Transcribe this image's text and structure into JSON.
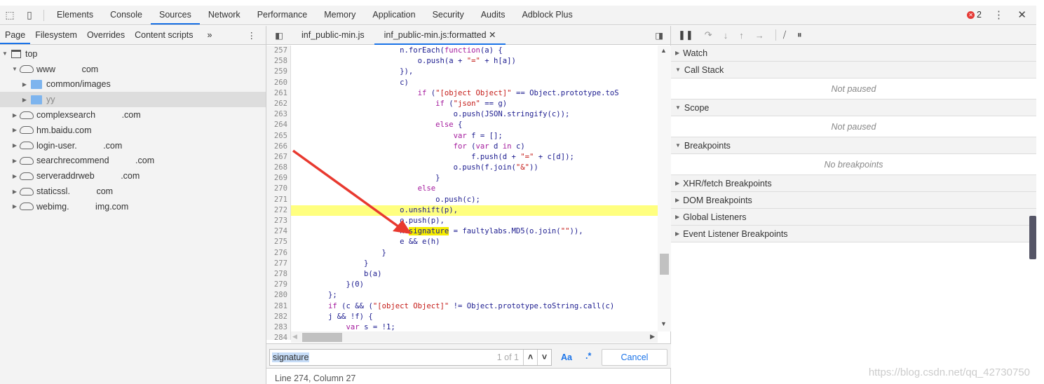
{
  "toolbar": {
    "tabs": [
      "Elements",
      "Console",
      "Sources",
      "Network",
      "Performance",
      "Memory",
      "Application",
      "Security",
      "Audits",
      "Adblock Plus"
    ],
    "active": "Sources",
    "error_count": "2"
  },
  "navigator": {
    "tabs": [
      "Page",
      "Filesystem",
      "Overrides",
      "Content scripts"
    ],
    "more": "»",
    "tree": [
      {
        "label": "top",
        "type": "frame",
        "expanded": true,
        "depth": 0
      },
      {
        "label": "www",
        "suffix": "com",
        "type": "cloud",
        "expanded": true,
        "depth": 1
      },
      {
        "label": "common/images",
        "type": "folder",
        "depth": 2
      },
      {
        "label": "yy",
        "type": "folder",
        "depth": 2,
        "selected": true
      },
      {
        "label": "complexsearch",
        "suffix": ".com",
        "type": "cloud",
        "depth": 1
      },
      {
        "label": "hm.baidu.com",
        "type": "cloud",
        "depth": 1
      },
      {
        "label": "login-user.",
        "suffix": ".com",
        "type": "cloud",
        "depth": 1
      },
      {
        "label": "searchrecommend",
        "suffix": ".com",
        "type": "cloud",
        "depth": 1
      },
      {
        "label": "serveraddrweb",
        "suffix": ".com",
        "type": "cloud",
        "depth": 1
      },
      {
        "label": "staticssl.",
        "suffix": "com",
        "type": "cloud",
        "depth": 1
      },
      {
        "label": "webimg.",
        "suffix": "img.com",
        "type": "cloud",
        "depth": 1
      }
    ]
  },
  "editor": {
    "tabs": [
      "inf_public-min.js",
      "inf_public-min.js:formatted"
    ],
    "active_tab": 1,
    "lines": [
      {
        "n": "257",
        "t": "                        n.forEach(function(a) {"
      },
      {
        "n": "258",
        "t": "                            o.push(a + \"=\" + h[a])"
      },
      {
        "n": "259",
        "t": "                        }),"
      },
      {
        "n": "260",
        "t": "                        c)"
      },
      {
        "n": "261",
        "t": "                            if (\"[object Object]\" == Object.prototype.toS"
      },
      {
        "n": "262",
        "t": "                                if (\"json\" == g)"
      },
      {
        "n": "263",
        "t": "                                    o.push(JSON.stringify(c));"
      },
      {
        "n": "264",
        "t": "                                else {"
      },
      {
        "n": "265",
        "t": "                                    var f = [];"
      },
      {
        "n": "266",
        "t": "                                    for (var d in c)"
      },
      {
        "n": "267",
        "t": "                                        f.push(d + \"=\" + c[d]);"
      },
      {
        "n": "268",
        "t": "                                    o.push(f.join(\"&\"))"
      },
      {
        "n": "269",
        "t": "                                }"
      },
      {
        "n": "270",
        "t": "                            else"
      },
      {
        "n": "271",
        "t": "                                o.push(c);"
      },
      {
        "n": "272",
        "t": "                        o.unshift(p),",
        "highlight": true
      },
      {
        "n": "273",
        "t": "                        o.push(p),"
      },
      {
        "n": "274",
        "t": "                        h.signature = faultylabs.MD5(o.join(\"\")),"
      },
      {
        "n": "275",
        "t": "                        e && e(h)"
      },
      {
        "n": "276",
        "t": "                    }"
      },
      {
        "n": "277",
        "t": "                }"
      },
      {
        "n": "278",
        "t": "                b(a)"
      },
      {
        "n": "279",
        "t": "            }(0)"
      },
      {
        "n": "280",
        "t": "        };"
      },
      {
        "n": "281",
        "t": "        if (c && (\"[object Object]\" != Object.prototype.toString.call(c)"
      },
      {
        "n": "282",
        "t": "        j && !f) {"
      },
      {
        "n": "283",
        "t": "            var s = !1;"
      },
      {
        "n": "284",
        "t": ""
      }
    ],
    "search": {
      "value": "signature",
      "count": "1 of 1",
      "case_label": "Aa",
      "regex_label": ".*",
      "cancel": "Cancel"
    },
    "status": "Line 274, Column 27"
  },
  "debugger": {
    "sections": [
      {
        "label": "Watch",
        "expanded": false
      },
      {
        "label": "Call Stack",
        "expanded": true,
        "empty": "Not paused"
      },
      {
        "label": "Scope",
        "expanded": true,
        "empty": "Not paused"
      },
      {
        "label": "Breakpoints",
        "expanded": true,
        "empty": "No breakpoints"
      },
      {
        "label": "XHR/fetch Breakpoints",
        "expanded": false
      },
      {
        "label": "DOM Breakpoints",
        "expanded": false
      },
      {
        "label": "Global Listeners",
        "expanded": false
      },
      {
        "label": "Event Listener Breakpoints",
        "expanded": false
      }
    ]
  },
  "watermark": "https://blog.csdn.net/qq_42730750",
  "colors": {
    "accent": "#1a73e8",
    "line_highlight": "#ffff7f",
    "match_highlight": "#f5ec00",
    "arrow": "#e8392f"
  }
}
